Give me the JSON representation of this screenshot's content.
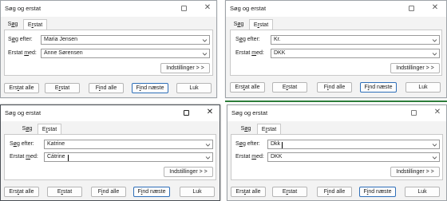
{
  "dialogs": [
    {
      "title": "Søg og erstat",
      "tabs": {
        "search": [
          "S",
          "ø",
          "g"
        ],
        "replace": [
          "E",
          "r",
          "stat"
        ]
      },
      "search_label": [
        "S",
        "ø",
        "g efter:"
      ],
      "replace_label": [
        "Erstat ",
        "m",
        "ed:"
      ],
      "search_value": "Maria Jensen",
      "replace_value": "Anne Sørensen",
      "options_button": "Indstillinger > >",
      "buttons": {
        "replace_all": [
          "Ers",
          "t",
          "at alle"
        ],
        "replace": [
          "E",
          "r",
          "stat"
        ],
        "find_all": [
          "F",
          "i",
          "nd alle"
        ],
        "find_next": [
          "F",
          "i",
          "nd næste"
        ],
        "close": "Luk"
      }
    },
    {
      "title": "Søg og erstat",
      "tabs": {
        "search": [
          "S",
          "ø",
          "g"
        ],
        "replace": [
          "E",
          "r",
          "stat"
        ]
      },
      "search_label": [
        "S",
        "ø",
        "g efter:"
      ],
      "replace_label": [
        "Erstat ",
        "m",
        "ed:"
      ],
      "search_value": "Kr.",
      "replace_value": "DKK",
      "options_button": "Indstillinger > >",
      "buttons": {
        "replace_all": [
          "Ers",
          "t",
          "at alle"
        ],
        "replace": [
          "E",
          "r",
          "stat"
        ],
        "find_all": [
          "F",
          "i",
          "nd alle"
        ],
        "find_next": [
          "F",
          "i",
          "nd næste"
        ],
        "close": "Luk"
      }
    },
    {
      "title": "Søg og erstat",
      "tabs": {
        "search": [
          "S",
          "ø",
          "g"
        ],
        "replace": [
          "E",
          "r",
          "stat"
        ]
      },
      "search_label": [
        "S",
        "ø",
        "g efter:"
      ],
      "replace_label": [
        "Erstat ",
        "m",
        "ed:"
      ],
      "search_value": "Katrine",
      "replace_value": "Cátrine",
      "options_button": "Indstillinger > >",
      "buttons": {
        "replace_all": [
          "Ers",
          "t",
          "at alle"
        ],
        "replace": [
          "E",
          "r",
          "stat"
        ],
        "find_all": [
          "F",
          "i",
          "nd alle"
        ],
        "find_next": [
          "F",
          "i",
          "nd næste"
        ],
        "close": "Luk"
      }
    },
    {
      "title": "Søg og erstat",
      "tabs": {
        "search": [
          "S",
          "ø",
          "g"
        ],
        "replace": [
          "E",
          "r",
          "stat"
        ]
      },
      "search_label": [
        "S",
        "ø",
        "g efter:"
      ],
      "replace_label": [
        "Erstat ",
        "m",
        "ed:"
      ],
      "search_value": "Dkk",
      "replace_value": "DKK",
      "options_button": "Indstillinger > >",
      "buttons": {
        "replace_all": [
          "Ers",
          "t",
          "at alle"
        ],
        "replace": [
          "E",
          "r",
          "stat"
        ],
        "find_all": [
          "F",
          "i",
          "nd alle"
        ],
        "find_next": [
          "F",
          "i",
          "nd næste"
        ],
        "close": "Luk"
      }
    }
  ],
  "icons": {
    "maximize": "square-outline",
    "close": "x-mark",
    "dropdown": "chevron-down"
  },
  "colors": {
    "primary_button_border": "#2f6fb8",
    "dialog_background": "#f3f3f3",
    "taskbar_accent": "#2d7d3b"
  }
}
